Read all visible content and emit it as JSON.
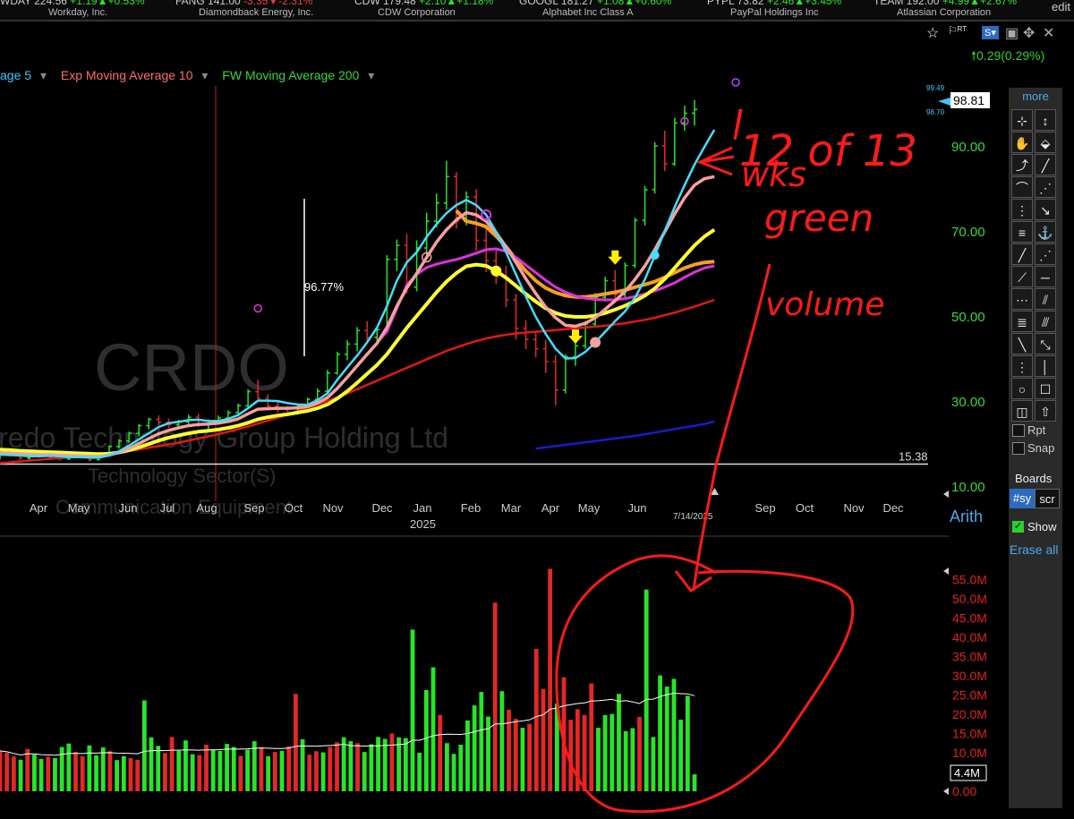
{
  "ticker": [
    {
      "sym": "WDAY",
      "price": "224.56",
      "chg": "+1.19",
      "pct": "+0.53%",
      "name": "Workday, Inc.",
      "dir": "up"
    },
    {
      "sym": "FANG",
      "price": "141.00",
      "chg": "-3.35",
      "pct": "-2.31%",
      "name": "Diamondback Energy, Inc.",
      "dir": "down"
    },
    {
      "sym": "CDW",
      "price": "179.48",
      "chg": "+2.10",
      "pct": "+1.18%",
      "name": "CDW Corporation",
      "dir": "up"
    },
    {
      "sym": "GOOGL",
      "price": "181.27",
      "chg": "+1.08",
      "pct": "+0.60%",
      "name": "Alphabet Inc Class A",
      "dir": "up"
    },
    {
      "sym": "PYPL",
      "price": "73.82",
      "chg": "+2.46",
      "pct": "+3.45%",
      "name": "PayPal Holdings Inc",
      "dir": "up"
    },
    {
      "sym": "TEAM",
      "price": "192.00",
      "chg": "+4.99",
      "pct": "+2.67%",
      "name": "Atlassian Corporation",
      "dir": "up"
    }
  ],
  "edit_label": "edit",
  "price_change": "0.29(0.29%)",
  "legend": [
    {
      "label": "age 5",
      "color": "#3ec9ff"
    },
    {
      "label": "Exp Moving Average 10",
      "color": "#ff7a7a"
    },
    {
      "label": "FW Moving Average 200",
      "color": "#39d639"
    }
  ],
  "watermark": {
    "symbol": "CRDO",
    "company": "Credo Technology Group Holding Ltd",
    "sector": "Technology Sector(S)",
    "industry": "Communication Equipment"
  },
  "measure_label": "96.77%",
  "last_price": "98.81",
  "price_hi": "99.49",
  "price_lo": "98.70",
  "ref_line_label": "15.38",
  "price_axis": [
    "90.00",
    "70.00",
    "50.00",
    "30.00",
    "10.00"
  ],
  "x_labels": [
    "Apr",
    "May",
    "Jun",
    "Jul",
    "Aug",
    "Sep",
    "Oct",
    "Nov",
    "Dec",
    "Jan",
    "Feb",
    "Mar",
    "Apr",
    "May",
    "Jun",
    "Sep",
    "Oct",
    "Nov",
    "Dec"
  ],
  "year_label": "2025",
  "date_label": "7/14/2025",
  "scale_label": "Arith",
  "volume_axis": [
    "55.0M",
    "50.0M",
    "45.0M",
    "40.0M",
    "35.0M",
    "30.0M",
    "25.0M",
    "20.0M",
    "15.0M",
    "10.0M",
    "0.00"
  ],
  "volume_current": "4.4M",
  "annotations": [
    "12 of 13",
    "wks",
    "green",
    "volume"
  ],
  "sidebar": {
    "more": "more",
    "rpt": "Rpt",
    "snap": "Snap",
    "boards": "Boards",
    "sym_tab": "#sy",
    "scr_tab": "scr",
    "show": "Show",
    "erase": "Erase all"
  },
  "colors": {
    "up": "#27e527",
    "down": "#e52727",
    "accent": "#4aa8e8",
    "annotation": "#ff1a1a"
  },
  "chart_data": {
    "type": "bar",
    "title": "",
    "candles": [
      [
        17.2,
        18.0,
        16.5,
        17.8
      ],
      [
        17.8,
        18.4,
        17.1,
        17.5
      ],
      [
        17.5,
        17.9,
        16.4,
        16.8
      ],
      [
        16.8,
        17.6,
        16.0,
        17.3
      ],
      [
        17.3,
        18.1,
        16.9,
        17.9
      ],
      [
        17.9,
        18.2,
        16.8,
        17.0
      ],
      [
        17.0,
        17.4,
        16.2,
        16.6
      ],
      [
        16.6,
        17.5,
        16.3,
        17.2
      ],
      [
        17.2,
        17.8,
        16.7,
        16.9
      ],
      [
        16.9,
        17.3,
        16.0,
        16.4
      ],
      [
        16.4,
        18.2,
        16.2,
        18.0
      ],
      [
        18.0,
        19.8,
        17.6,
        19.5
      ],
      [
        19.5,
        21.2,
        19.0,
        20.8
      ],
      [
        20.8,
        23.0,
        20.3,
        22.6
      ],
      [
        22.6,
        24.8,
        21.9,
        24.4
      ],
      [
        24.4,
        26.3,
        23.6,
        25.9
      ],
      [
        25.9,
        26.8,
        24.5,
        25.2
      ],
      [
        25.2,
        26.1,
        23.9,
        24.6
      ],
      [
        24.6,
        25.8,
        24.0,
        25.3
      ],
      [
        25.3,
        27.0,
        24.6,
        26.4
      ],
      [
        26.4,
        27.2,
        24.1,
        24.8
      ],
      [
        24.8,
        25.9,
        23.3,
        25.4
      ],
      [
        25.4,
        26.8,
        24.9,
        26.2
      ],
      [
        26.2,
        28.0,
        25.7,
        27.5
      ],
      [
        27.5,
        29.6,
        26.9,
        29.1
      ],
      [
        29.1,
        33.0,
        28.5,
        32.4
      ],
      [
        32.4,
        35.2,
        30.1,
        30.8
      ],
      [
        30.8,
        31.8,
        28.2,
        29.0
      ],
      [
        29.0,
        30.5,
        27.5,
        28.2
      ],
      [
        28.2,
        29.1,
        26.6,
        27.4
      ],
      [
        27.4,
        29.5,
        27.0,
        29.1
      ],
      [
        29.1,
        31.0,
        28.6,
        30.6
      ],
      [
        30.6,
        33.2,
        29.8,
        32.5
      ],
      [
        32.5,
        37.5,
        32.0,
        36.8
      ],
      [
        36.8,
        41.8,
        36.4,
        41.2
      ],
      [
        41.2,
        44.5,
        39.8,
        43.6
      ],
      [
        43.6,
        47.6,
        41.9,
        46.8
      ],
      [
        46.8,
        49.0,
        44.0,
        45.2
      ],
      [
        45.2,
        47.5,
        44.0,
        47.0
      ],
      [
        47.0,
        64.5,
        46.5,
        63.5
      ],
      [
        63.5,
        68.2,
        60.8,
        66.8
      ],
      [
        66.8,
        69.5,
        55.5,
        57.0
      ],
      [
        57.0,
        68.0,
        56.0,
        66.2
      ],
      [
        66.2,
        74.5,
        64.2,
        72.5
      ],
      [
        72.5,
        79.0,
        71.0,
        76.8
      ],
      [
        76.8,
        86.7,
        75.2,
        83.0
      ],
      [
        83.0,
        84.0,
        70.8,
        72.5
      ],
      [
        72.5,
        79.5,
        71.5,
        78.2
      ],
      [
        78.2,
        80.0,
        65.5,
        68.0
      ],
      [
        68.0,
        71.5,
        60.5,
        63.2
      ],
      [
        63.2,
        65.8,
        57.8,
        59.5
      ],
      [
        59.5,
        62.0,
        52.3,
        54.0
      ],
      [
        54.0,
        55.4,
        44.7,
        47.3
      ],
      [
        47.3,
        49.2,
        42.4,
        44.7
      ],
      [
        44.7,
        46.3,
        40.5,
        42.5
      ],
      [
        42.5,
        44.6,
        36.8,
        39.5
      ],
      [
        39.5,
        41.0,
        29.2,
        32.8
      ],
      [
        32.8,
        41.2,
        32.0,
        40.6
      ],
      [
        40.6,
        44.0,
        38.5,
        43.2
      ],
      [
        43.2,
        49.0,
        42.5,
        48.3
      ],
      [
        48.3,
        55.6,
        47.5,
        54.6
      ],
      [
        54.6,
        59.4,
        53.6,
        58.5
      ],
      [
        58.5,
        61.0,
        53.8,
        55.2
      ],
      [
        55.2,
        62.8,
        54.6,
        62.1
      ],
      [
        62.1,
        73.3,
        61.5,
        72.7
      ],
      [
        72.7,
        80.8,
        71.5,
        79.9
      ],
      [
        79.9,
        91.1,
        79.0,
        90.2
      ],
      [
        90.2,
        93.8,
        84.3,
        86.0
      ],
      [
        86.0,
        96.8,
        85.5,
        95.6
      ],
      [
        95.6,
        99.7,
        93.8,
        97.9
      ],
      [
        97.9,
        101.0,
        95.0,
        98.8
      ]
    ],
    "volume_millions": [
      10.5,
      10.0,
      9.0,
      8.2,
      11.0,
      9.5,
      8.4,
      9.0,
      8.6,
      11.5,
      12.4,
      10.2,
      9.1,
      11.9,
      9.3,
      11.4,
      10.4,
      8.1,
      9.1,
      8.6,
      8.2,
      23.6,
      14.0,
      11.8,
      9.9,
      14.1,
      10.5,
      13.2,
      9.6,
      9.4,
      12.1,
      10.7,
      10.5,
      12.3,
      11.5,
      9.2,
      10.8,
      13.0,
      11.4,
      9.1,
      10.2,
      10.5,
      11.7,
      25.3,
      13.5,
      9.5,
      10.4,
      10.1,
      11.5,
      12.7,
      14.0,
      13.0,
      12.5,
      10.2,
      12.2,
      14.1,
      13.6,
      15.0,
      14.0,
      13.8,
      42.0,
      10.0,
      26.3,
      32.2,
      19.8,
      12.5,
      9.7,
      12.1,
      18.4,
      22.3,
      25.8,
      19.4,
      49.0,
      26.0,
      21.2,
      18.8,
      16.5,
      17.5,
      37.0,
      26.6,
      57.8,
      22.8,
      29.6,
      18.6,
      21.3,
      19.8,
      28.0,
      16.5,
      19.8,
      20.1,
      25.3,
      15.6,
      16.4,
      19.3,
      52.4,
      14.1,
      30.1,
      27.2,
      29.2,
      18.6,
      24.8,
      4.4
    ],
    "volume_up": [
      false,
      false,
      false,
      true,
      false,
      true,
      true,
      false,
      true,
      true,
      true,
      false,
      false,
      true,
      true,
      true,
      false,
      true,
      true,
      false,
      false,
      true,
      true,
      true,
      false,
      false,
      true,
      true,
      true,
      false,
      false,
      true,
      true,
      true,
      true,
      false,
      true,
      true,
      false,
      true,
      false,
      true,
      false,
      false,
      true,
      false,
      false,
      true,
      false,
      false,
      true,
      true,
      false,
      true,
      true,
      true,
      true,
      false,
      true,
      true,
      true,
      true,
      true,
      true,
      false,
      true,
      true,
      true,
      true,
      true,
      true,
      true,
      false,
      true,
      false,
      false,
      true,
      false,
      false,
      false,
      false,
      true,
      false,
      false,
      false,
      false,
      false,
      true,
      true,
      true,
      true,
      true,
      true,
      false,
      true,
      true,
      true,
      true,
      true,
      true,
      true,
      true
    ],
    "ma_fast": [
      17.6,
      17.5,
      17.4,
      17.2,
      17.2,
      17.3,
      17.2,
      17.0,
      17.0,
      16.9,
      16.9,
      17.4,
      18.4,
      19.7,
      21.2,
      22.6,
      24.1,
      25.0,
      25.3,
      25.7,
      25.8,
      25.5,
      25.5,
      26.0,
      26.9,
      28.5,
      30.3,
      30.3,
      30.2,
      29.7,
      29.4,
      29.3,
      30.4,
      32.0,
      35.2,
      38.1,
      40.9,
      44.0,
      47.5,
      52.5,
      58.5,
      62.8,
      65.2,
      68.8,
      71.8,
      74.4,
      76.3,
      77.5,
      76.3,
      74.0,
      70.0,
      65.2,
      60.0,
      54.8,
      50.0,
      46.0,
      42.5,
      40.2,
      40.3,
      41.8,
      44.0,
      46.5,
      49.0,
      51.3,
      54.5,
      58.8,
      64.5,
      70.2,
      75.8,
      81.0,
      85.8,
      90.0,
      94.0
    ],
    "ema_mid": [
      18.0,
      17.9,
      17.8,
      17.7,
      17.6,
      17.6,
      17.5,
      17.4,
      17.3,
      17.2,
      17.2,
      17.5,
      18.1,
      19.0,
      20.2,
      21.4,
      22.5,
      23.3,
      23.9,
      24.4,
      24.7,
      24.8,
      25.0,
      25.4,
      26.0,
      27.2,
      28.3,
      28.4,
      28.5,
      28.5,
      28.6,
      28.9,
      29.7,
      31.0,
      33.2,
      35.8,
      38.5,
      41.2,
      43.8,
      47.5,
      52.5,
      56.8,
      60.2,
      64.0,
      67.6,
      70.5,
      72.8,
      74.5,
      74.0,
      72.5,
      69.8,
      66.5,
      62.8,
      59.0,
      55.5,
      52.3,
      49.8,
      48.0,
      47.8,
      48.5,
      49.8,
      51.8,
      53.8,
      56.0,
      58.8,
      62.0,
      65.8,
      70.0,
      74.2,
      78.0,
      81.0,
      82.5,
      83.0
    ],
    "ema_slow": [
      18.8,
      18.7,
      18.5,
      18.4,
      18.3,
      18.2,
      18.1,
      18.0,
      17.9,
      17.8,
      17.7,
      17.8,
      18.1,
      18.6,
      19.3,
      20.1,
      20.9,
      21.6,
      22.1,
      22.6,
      23.0,
      23.2,
      23.5,
      23.9,
      24.4,
      25.1,
      25.9,
      26.4,
      26.8,
      27.1,
      27.5,
      27.9,
      28.5,
      29.4,
      30.8,
      32.5,
      34.5,
      36.6,
      38.7,
      41.2,
      44.3,
      47.4,
      50.2,
      53.0,
      55.8,
      58.3,
      60.3,
      61.9,
      62.3,
      62.0,
      60.8,
      59.2,
      57.3,
      55.4,
      53.6,
      52.0,
      50.9,
      50.2,
      50.0,
      50.0,
      50.3,
      50.9,
      51.7,
      52.6,
      53.7,
      55.0,
      56.7,
      58.9,
      61.5,
      64.2,
      66.8,
      68.9,
      70.5
    ],
    "ma_pink": [
      null,
      null,
      null,
      null,
      null,
      null,
      null,
      null,
      null,
      null,
      null,
      null,
      null,
      null,
      null,
      null,
      null,
      null,
      null,
      null,
      null,
      null,
      null,
      null,
      null,
      null,
      null,
      null,
      null,
      null,
      null,
      null,
      null,
      null,
      null,
      null,
      null,
      null,
      44.0,
      46.5,
      52.0,
      57.5,
      60.0,
      61.6,
      62.4,
      63.0,
      63.5,
      64.2,
      65.0,
      65.8,
      66.0,
      65.4,
      64.0,
      62.2,
      60.4,
      58.6,
      57.0,
      55.8,
      54.9,
      54.4,
      54.1,
      54.0,
      54.0,
      54.3,
      54.8,
      55.4,
      56.1,
      57.0,
      58.0,
      59.3,
      60.5,
      61.5,
      62.0
    ],
    "ma_orange": [
      null,
      null,
      null,
      null,
      null,
      null,
      null,
      null,
      null,
      null,
      null,
      null,
      null,
      null,
      null,
      null,
      null,
      null,
      null,
      null,
      null,
      null,
      null,
      null,
      null,
      null,
      null,
      null,
      null,
      null,
      null,
      null,
      null,
      null,
      null,
      null,
      null,
      null,
      null,
      null,
      null,
      null,
      null,
      null,
      null,
      null,
      75.0,
      72.5,
      72.0,
      71.2,
      69.0,
      66.5,
      63.5,
      60.8,
      58.5,
      56.8,
      55.7,
      55.0,
      54.7,
      54.7,
      55.0,
      55.4,
      55.8,
      56.3,
      57.0,
      57.6,
      58.3,
      59.3,
      60.4,
      61.5,
      62.3,
      62.8,
      63.0
    ],
    "ma_red": [
      15.6,
      15.8,
      16.0,
      16.2,
      16.4,
      16.6,
      16.8,
      17.0,
      17.2,
      17.4,
      17.6,
      17.9,
      18.2,
      18.5,
      18.8,
      19.2,
      19.6,
      20.0,
      20.4,
      20.9,
      21.4,
      21.9,
      22.4,
      23.0,
      23.6,
      24.2,
      24.9,
      25.6,
      26.3,
      27.0,
      27.8,
      28.6,
      29.4,
      30.2,
      31.1,
      32.0,
      33.0,
      34.0,
      35.0,
      36.0,
      37.0,
      38.0,
      39.0,
      40.0,
      41.0,
      42.0,
      42.8,
      43.6,
      44.3,
      44.9,
      45.4,
      45.8,
      46.1,
      46.3,
      46.5,
      46.7,
      46.9,
      47.1,
      47.3,
      47.5,
      47.7,
      47.9,
      48.2,
      48.5,
      48.9,
      49.3,
      49.8,
      50.4,
      51.0,
      51.7,
      52.4,
      53.2,
      54.0
    ],
    "ma_blue": [
      null,
      null,
      null,
      null,
      null,
      null,
      null,
      null,
      null,
      null,
      null,
      null,
      null,
      null,
      null,
      null,
      null,
      null,
      null,
      null,
      null,
      null,
      null,
      null,
      null,
      null,
      null,
      null,
      null,
      null,
      null,
      null,
      null,
      null,
      null,
      null,
      null,
      null,
      null,
      null,
      null,
      null,
      null,
      null,
      null,
      null,
      null,
      null,
      null,
      null,
      null,
      null,
      null,
      null,
      19.0,
      19.3,
      19.6,
      19.9,
      20.2,
      20.5,
      20.8,
      21.1,
      21.4,
      21.7,
      22.0,
      22.4,
      22.8,
      23.2,
      23.6,
      24.0,
      24.4,
      24.8,
      25.4
    ],
    "ylim": [
      10,
      100
    ],
    "vol_ylim": [
      0,
      58
    ],
    "reference_line": 15.38
  }
}
